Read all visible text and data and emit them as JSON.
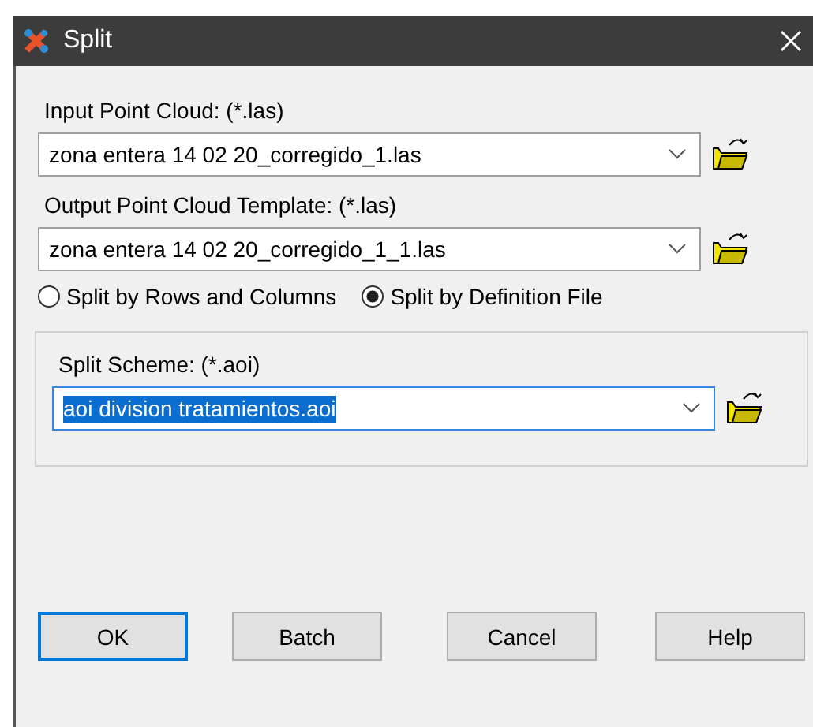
{
  "window": {
    "title": "Split"
  },
  "input": {
    "label": "Input Point Cloud: (*.las)",
    "value": "zona entera 14 02 20_corregido_1.las"
  },
  "output": {
    "label": "Output Point Cloud Template: (*.las)",
    "value": "zona entera 14 02 20_corregido_1_1.las"
  },
  "split_mode": [
    {
      "label": "Split by Rows and Columns",
      "selected": false
    },
    {
      "label": "Split by Definition File",
      "selected": true
    }
  ],
  "scheme": {
    "label": "Split Scheme: (*.aoi)",
    "value": "aoi division tratamientos.aoi",
    "text_selected": true
  },
  "buttons": [
    {
      "label": "OK",
      "default": true
    },
    {
      "label": "Batch",
      "default": false
    },
    {
      "label": "Cancel",
      "default": false
    },
    {
      "label": "Help",
      "default": false
    }
  ]
}
